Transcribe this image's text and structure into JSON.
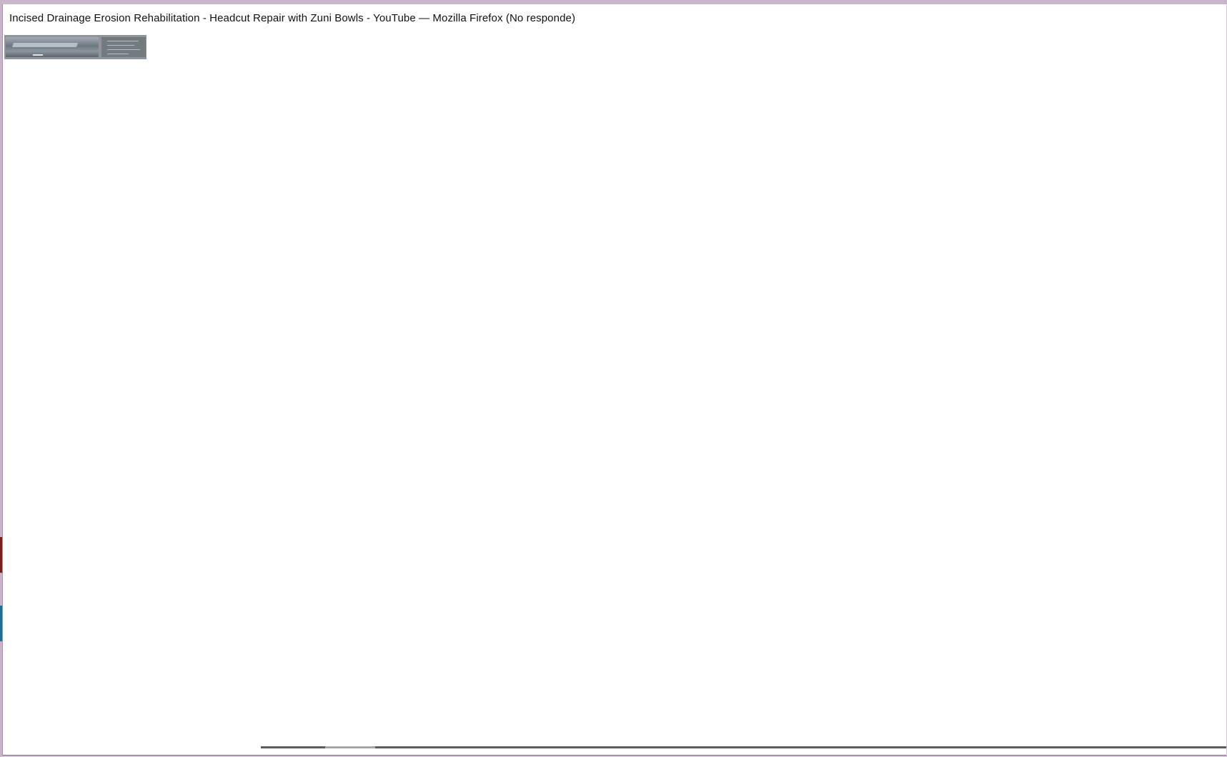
{
  "window": {
    "title": "Incised Drainage Erosion Rehabilitation - Headcut Repair with Zuni Bowls - YouTube — Mozilla Firefox (No responde)"
  },
  "thumbnail": {
    "icon": "video-thumbnail-preview"
  },
  "colors": {
    "desktop_background": "#d8c5dc",
    "window_background": "#ffffff",
    "title_text": "#111111"
  }
}
